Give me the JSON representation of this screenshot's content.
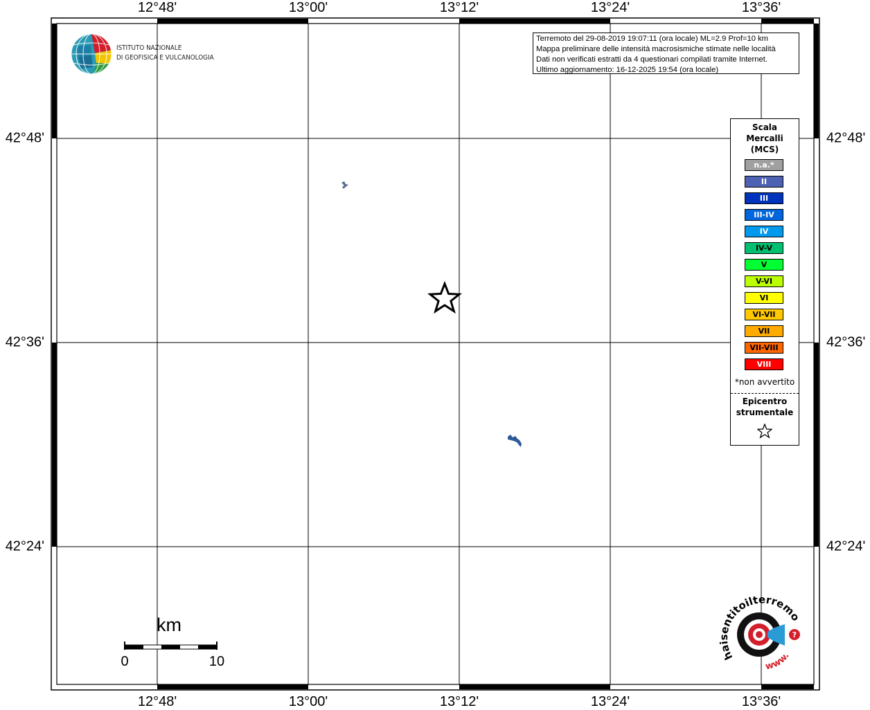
{
  "ticks": {
    "longitude": [
      "12°48'",
      "13°00'",
      "13°12'",
      "13°24'",
      "13°36'"
    ],
    "latitude": [
      "42°48'",
      "42°36'",
      "42°24'"
    ]
  },
  "info_box": {
    "line1": "Terremoto del 29-08-2019 19:07:11 (ora locale) ML=2.9 Prof=10 km",
    "line2": "Mappa preliminare delle intensità macrosismiche stimate nelle località",
    "line3": "Dati non verificati estratti da 4 questionari compilati tramite Internet.",
    "line4": "Ultimo aggiornamento: 16-12-2025 19:54 (ora locale)"
  },
  "logo_ingv": {
    "line1": "ISTITUTO NAZIONALE",
    "line2": "DI GEOFISICA E VULCANOLOGIA"
  },
  "legend": {
    "title1": "Scala",
    "title2": "Mercalli",
    "title3": "(MCS)",
    "items": [
      {
        "label": "n.a.*",
        "color": "#a0a0a0",
        "text_color": "#ffffff"
      },
      {
        "label": "II",
        "color": "#4d62b3",
        "text_color": "#ffffff"
      },
      {
        "label": "III",
        "color": "#0033bb",
        "text_color": "#ffffff"
      },
      {
        "label": "III-IV",
        "color": "#0066dd",
        "text_color": "#ffffff"
      },
      {
        "label": "IV",
        "color": "#0099ee",
        "text_color": "#ffffff"
      },
      {
        "label": "IV-V",
        "color": "#00c070",
        "text_color": "#000000"
      },
      {
        "label": "V",
        "color": "#00ff33",
        "text_color": "#000000"
      },
      {
        "label": "V-VI",
        "color": "#bbff00",
        "text_color": "#000000"
      },
      {
        "label": "VI",
        "color": "#ffff00",
        "text_color": "#000000"
      },
      {
        "label": "VI-VII",
        "color": "#ffc800",
        "text_color": "#000000"
      },
      {
        "label": "VII",
        "color": "#ffaa00",
        "text_color": "#000000"
      },
      {
        "label": "VII-VIII",
        "color": "#ff6600",
        "text_color": "#000000"
      },
      {
        "label": "VIII",
        "color": "#ff0000",
        "text_color": "#ffffff"
      }
    ],
    "note": "*non avvertito",
    "epicenter_line1": "Epicentro",
    "epicenter_line2": "strumentale"
  },
  "scale_bar": {
    "unit": "km",
    "start": "0",
    "end": "10"
  },
  "logo_hsit": {
    "text_main": "haisentitoilterremoto.it",
    "text_www": "www."
  },
  "colors": {
    "frame": "#000000",
    "grid": "#000000",
    "area_fill": "#2f5a9a",
    "small_area_fill": "#5a6a90"
  }
}
